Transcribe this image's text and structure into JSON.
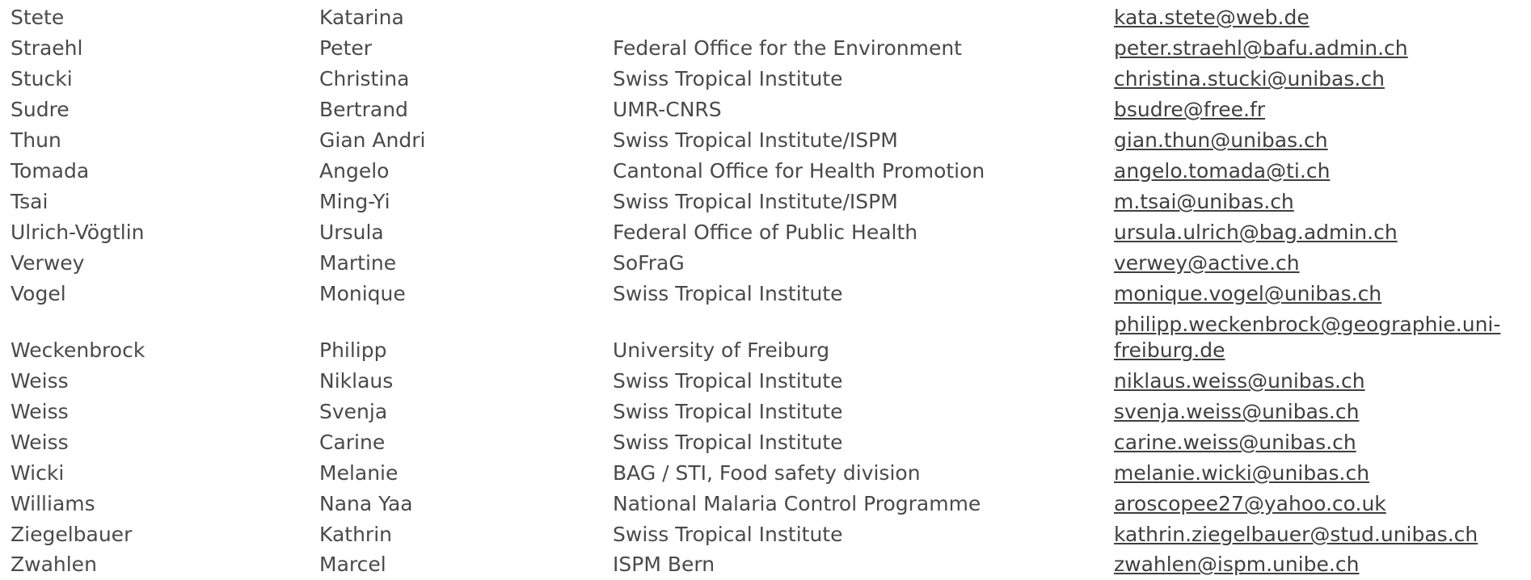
{
  "rows": [
    {
      "last": "Stete",
      "first": "Katarina",
      "org": "",
      "email": "kata.stete@web.de"
    },
    {
      "last": "Straehl",
      "first": "Peter",
      "org": "Federal Office for the Environment",
      "email": "peter.straehl@bafu.admin.ch"
    },
    {
      "last": "Stucki",
      "first": "Christina",
      "org": "Swiss Tropical Institute",
      "email": "christina.stucki@unibas.ch"
    },
    {
      "last": "Sudre",
      "first": "Bertrand",
      "org": "UMR-CNRS",
      "email": "bsudre@free.fr"
    },
    {
      "last": "Thun",
      "first": "Gian Andri",
      "org": "Swiss Tropical Institute/ISPM",
      "email": "gian.thun@unibas.ch"
    },
    {
      "last": "Tomada",
      "first": "Angelo",
      "org": "Cantonal Office for Health Promotion",
      "email": "angelo.tomada@ti.ch"
    },
    {
      "last": "Tsai",
      "first": "Ming-Yi",
      "org": "Swiss Tropical Institute/ISPM",
      "email": "m.tsai@unibas.ch"
    },
    {
      "last": "Ulrich-Vögtlin",
      "first": "Ursula",
      "org": "Federal Office of Public Health",
      "email": "ursula.ulrich@bag.admin.ch"
    },
    {
      "last": "Verwey",
      "first": "Martine",
      "org": "SoFraG",
      "email": "verwey@active.ch"
    },
    {
      "last": "Vogel",
      "first": "Monique",
      "org": "Swiss Tropical Institute",
      "email": "monique.vogel@unibas.ch"
    },
    {
      "last": "Weckenbrock",
      "first": "Philipp",
      "org": "University of Freiburg",
      "email": "philipp.weckenbrock@geographie.uni-freiburg.de",
      "email_line1": "philipp.weckenbrock@geographie.uni-",
      "email_line2": "freiburg.de"
    },
    {
      "last": "Weiss",
      "first": "Niklaus",
      "org": "Swiss Tropical Institute",
      "email": "niklaus.weiss@unibas.ch"
    },
    {
      "last": "Weiss",
      "first": "Svenja",
      "org": "Swiss Tropical Institute",
      "email": "svenja.weiss@unibas.ch"
    },
    {
      "last": "Weiss",
      "first": "Carine",
      "org": "Swiss Tropical Institute",
      "email": "carine.weiss@unibas.ch"
    },
    {
      "last": "Wicki",
      "first": "Melanie",
      "org": "BAG / STI, Food safety division",
      "email": "melanie.wicki@unibas.ch"
    },
    {
      "last": "Williams",
      "first": "Nana Yaa",
      "org": "National Malaria Control Programme",
      "email": "aroscopee27@yahoo.co.uk"
    },
    {
      "last": "Ziegelbauer",
      "first": "Kathrin",
      "org": "Swiss Tropical Institute",
      "email": "kathrin.ziegelbauer@stud.unibas.ch"
    },
    {
      "last": "Zwahlen",
      "first": "Marcel",
      "org": "ISPM Bern",
      "email": "zwahlen@ispm.unibe.ch"
    }
  ]
}
